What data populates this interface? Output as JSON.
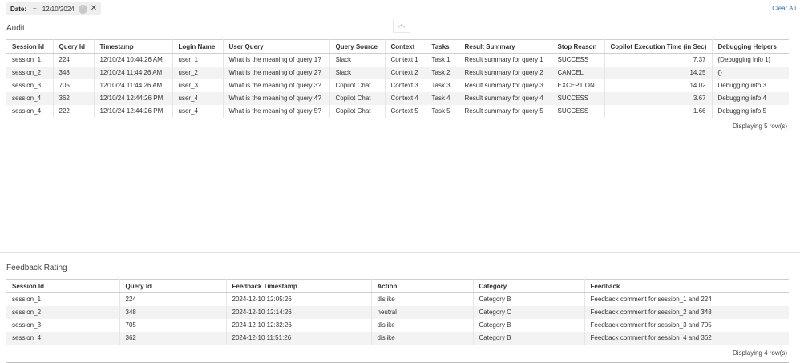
{
  "filter": {
    "label": "Date:",
    "operator": "=",
    "value": "12/10/2024",
    "badge": "1",
    "close_glyph": "✕",
    "clear_all": "Clear All"
  },
  "audit": {
    "title": "Audit",
    "columns": [
      "Session Id",
      "Query Id",
      "Timestamp",
      "Login Name",
      "User Query",
      "Query Source",
      "Context",
      "Tasks",
      "Result Summary",
      "Stop Reason",
      "Copilot Execution Time (in Sec)",
      "Debugging Helpers"
    ],
    "rows": [
      [
        "session_1",
        "224",
        "12/10/24 10:44:26 AM",
        "user_1",
        "What is the meaning of query 1?",
        "Slack",
        "Context 1",
        "Task 1",
        "Result summary for query 1",
        "SUCCESS",
        "7.37",
        "{Debugging info 1}"
      ],
      [
        "session_2",
        "348",
        "12/10/24 11:44:26 AM",
        "user_2",
        "What is the meaning of query 2?",
        "Slack",
        "Context 2",
        "Task 2",
        "Result summary for query 2",
        "CANCEL",
        "14.25",
        "{}"
      ],
      [
        "session_3",
        "705",
        "12/10/24 11:44:26 AM",
        "user_3",
        "What is the meaning of query 3?",
        "Copilot Chat",
        "Context 3",
        "Task 3",
        "Result summary for query 3",
        "EXCEPTION",
        "14.02",
        "Debugging info 3"
      ],
      [
        "session_4",
        "362",
        "12/10/24 12:44:26 PM",
        "user_4",
        "What is the meaning of query 4?",
        "Copilot Chat",
        "Context 4",
        "Task 4",
        "Result summary for query 4",
        "SUCCESS",
        "3.67",
        "Debugging info 4"
      ],
      [
        "session_4",
        "222",
        "12/10/24 12:44:26 PM",
        "user_4",
        "What is the meaning of query 5?",
        "Copilot Chat",
        "Context 5",
        "Task 5",
        "Result summary for query 5",
        "SUCCESS",
        "1.66",
        "Debugging info 5"
      ]
    ],
    "row_count": "Displaying 5 row(s)"
  },
  "feedback": {
    "title": "Feedback Rating",
    "columns": [
      "Session Id",
      "Query Id",
      "Feedback Timestamp",
      "Action",
      "Category",
      "Feedback"
    ],
    "rows": [
      [
        "session_1",
        "224",
        "2024-12-10 12:05:26",
        "dislike",
        "Category B",
        "Feedback comment for session_1 and 224"
      ],
      [
        "session_2",
        "348",
        "2024-12-10 12:14:26",
        "neutral",
        "Category C",
        "Feedback comment for session_2 and 348"
      ],
      [
        "session_3",
        "705",
        "2024-12-10 12:32:26",
        "dislike",
        "Category B",
        "Feedback comment for session_3 and 705"
      ],
      [
        "session_4",
        "362",
        "2024-12-10 11:51:26",
        "dislike",
        "Category B",
        "Feedback comment for session_4 and 362"
      ]
    ],
    "row_count": "Displaying 4 row(s)"
  }
}
